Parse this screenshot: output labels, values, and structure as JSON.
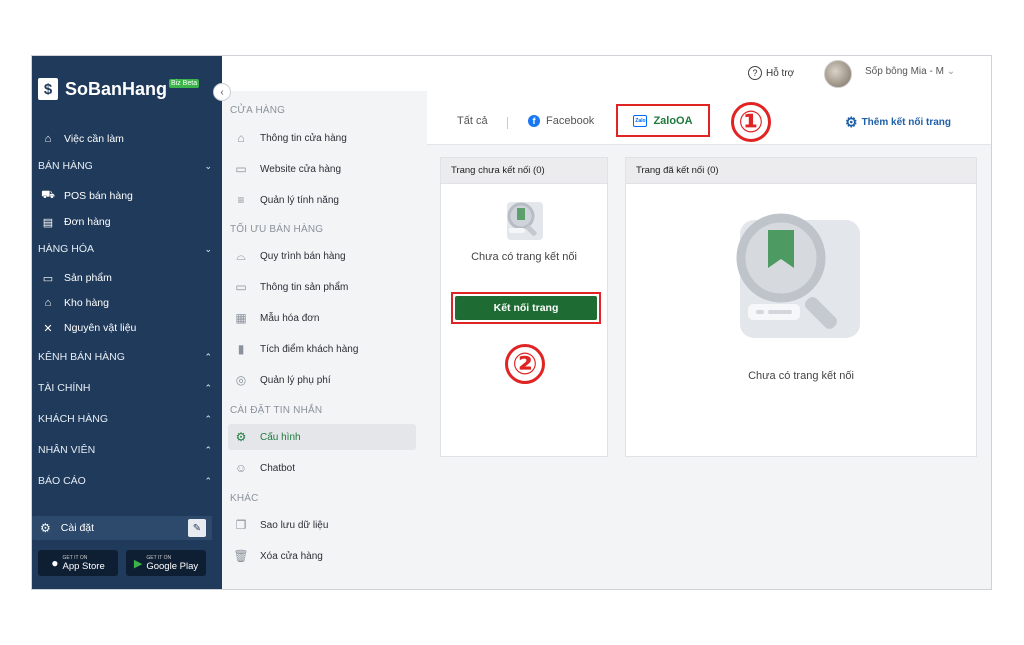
{
  "brand": {
    "name": "SoBanHang",
    "badge": "Biz Beta"
  },
  "header": {
    "help": "Hỗ trợ",
    "user": "Sốp bông Mia - M"
  },
  "sidebar": {
    "todo": "Việc cần làm",
    "group_sales": "BÁN HÀNG",
    "pos": "POS bán hàng",
    "orders": "Đơn hàng",
    "group_goods": "HÀNG HÓA",
    "products": "Sản phẩm",
    "warehouse": "Kho hàng",
    "materials": "Nguyên vật liệu",
    "group_channels": "KÊNH BÁN HÀNG",
    "group_finance": "TÀI CHÍNH",
    "group_customers": "KHÁCH HÀNG",
    "group_staff": "NHÂN VIÊN",
    "group_reports": "BÁO CÁO",
    "settings": "Cài đặt",
    "app_store_small": "GET IT ON",
    "app_store": "App Store",
    "google_play_small": "GET IT ON",
    "google_play": "Google Play"
  },
  "menu": {
    "h_store": "CỬA HÀNG",
    "store_info": "Thông tin cửa hàng",
    "website": "Website cửa hàng",
    "features": "Quản lý tính năng",
    "h_optimize": "TỐI ƯU BÁN HÀNG",
    "sales_process": "Quy trình bán hàng",
    "product_info": "Thông tin sản phẩm",
    "invoice_template": "Mẫu hóa đơn",
    "loyalty": "Tích điểm khách hàng",
    "surcharge": "Quản lý phụ phí",
    "h_messages": "CÀI ĐẶT TIN NHẮN",
    "config": "Cấu hình",
    "chatbot": "Chatbot",
    "h_other": "KHÁC",
    "backup": "Sao lưu dữ liệu",
    "delete_store": "Xóa cửa hàng"
  },
  "tabs": {
    "all": "Tất cả",
    "facebook": "Facebook",
    "zalo": "ZaloOA",
    "add_connection": "Thêm kết nối trang"
  },
  "annotations": {
    "one": "①",
    "two": "②"
  },
  "cards": {
    "unconnected_title": "Trang chưa kết nối (0)",
    "unconnected_empty": "Chưa có trang kết nối",
    "connect_button": "Kết nối trang",
    "connected_title": "Trang đã kết nối (0)",
    "connected_empty": "Chưa có trang kết nối"
  },
  "colors": {
    "sidebar": "#1f3a5a",
    "accent_green": "#1e6b33",
    "highlight_red": "#e02424",
    "link_blue": "#1f5fa8"
  }
}
